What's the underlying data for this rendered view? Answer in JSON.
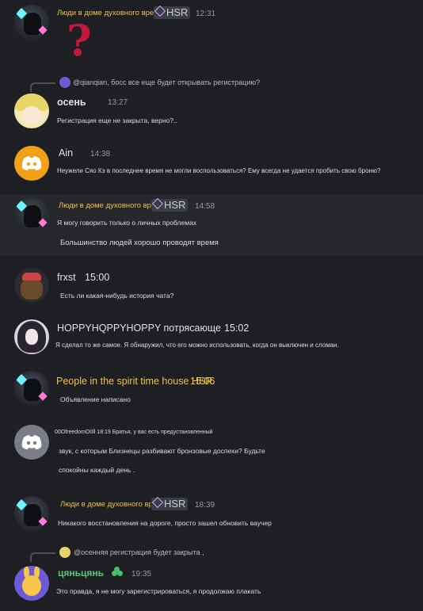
{
  "messages": [
    {
      "name": "Люди в доме духовного времени",
      "tag": "HSR",
      "time": "12:31",
      "reaction": "?"
    },
    {
      "reply": "@qianqian, босс все еще будет открывать регистрацию?",
      "name": "осень",
      "time": "13:27",
      "text": "Регистрация еще не закрыта, верно?.."
    },
    {
      "name": "Ain",
      "time": "14:38",
      "text": "Неужели Сяо Кэ в последнее время не могли воспользоваться? Ему всегда не удается пробить свою броню?"
    },
    {
      "name": "Люди в доме духовного времени",
      "tag": "HSR",
      "time": "14:58",
      "text": "Я могу говорить только о личных проблемах",
      "text2": "Большинство людей хорошо проводят время"
    },
    {
      "name": "frxst",
      "time": "15:00",
      "text": "Есть ли какая-нибудь история чата?"
    },
    {
      "name": "HOPPYHQPPYHOPPY потрясающе",
      "time": "15:02",
      "text": "Я сделал то же самое. Я обнаружил, что его можно использовать, когда он выключен и сломан."
    },
    {
      "name": "People in the spirit time house HSR",
      "time": "15:06",
      "text": "Объявление написано"
    },
    {
      "header": "00OfreedomO0ll 18:19 Братья, у вас есть предустановленный",
      "text": "звук, с которым Близнецы разбивают бронзовые доспехи? Будьте",
      "text2": "спокойны каждый день ."
    },
    {
      "name": "Люди в доме духовного времени",
      "tag": "HSR",
      "time": "18:39",
      "text": "Никакого восстановления на дороге, просто зашел обновить ваучер"
    },
    {
      "reply": "@осенняя регистрация будет закрыта ,",
      "name": "цяньцянь",
      "time": "19:35",
      "text": "Это правда, я не могу зарегистрироваться, я продолжаю плакать"
    }
  ]
}
